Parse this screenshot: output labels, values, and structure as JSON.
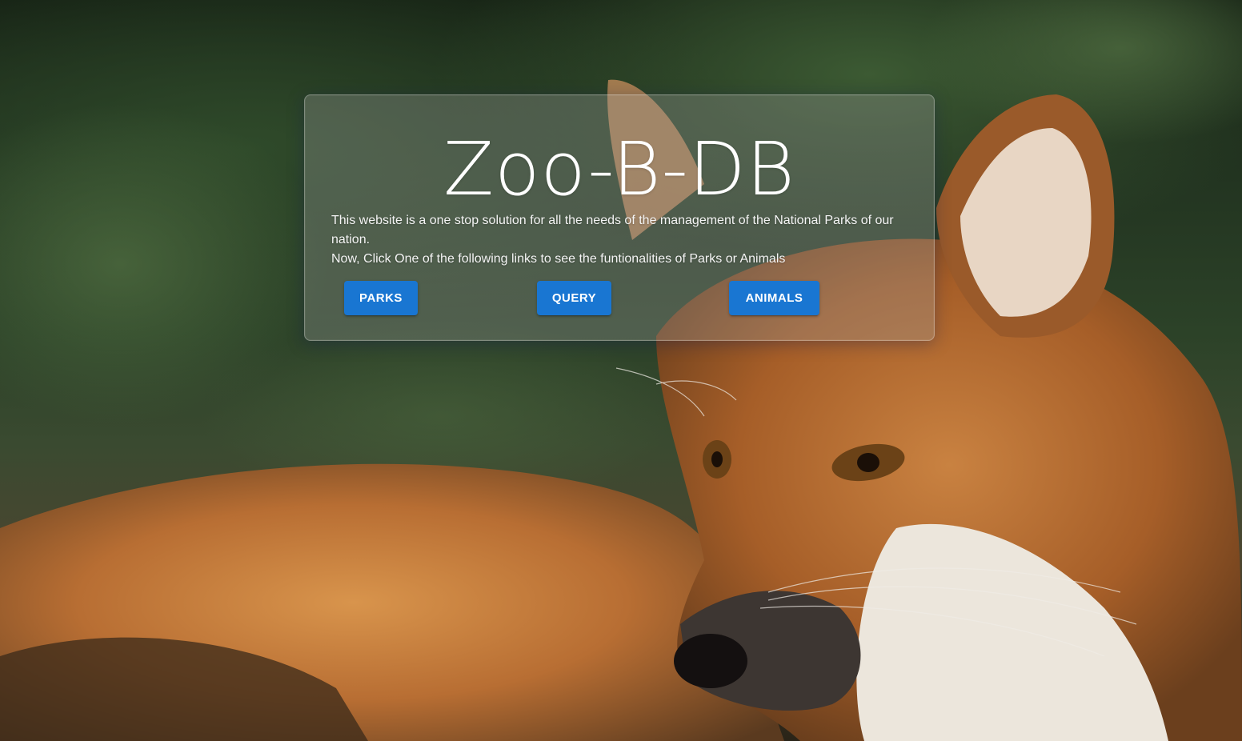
{
  "app": {
    "title": "Zoo-B-DB",
    "description_line1": "This website is a one stop solution for all the needs of the management of the National Parks of our nation.",
    "description_line2": "Now, Click One of the following links to see the funtionalities of Parks or Animals"
  },
  "buttons": {
    "parks_label": "PARKS",
    "query_label": "QUERY",
    "animals_label": "ANIMALS"
  },
  "colors": {
    "button_bg": "#1976d2",
    "button_text": "#ffffff",
    "title_text": "#ffffff"
  }
}
